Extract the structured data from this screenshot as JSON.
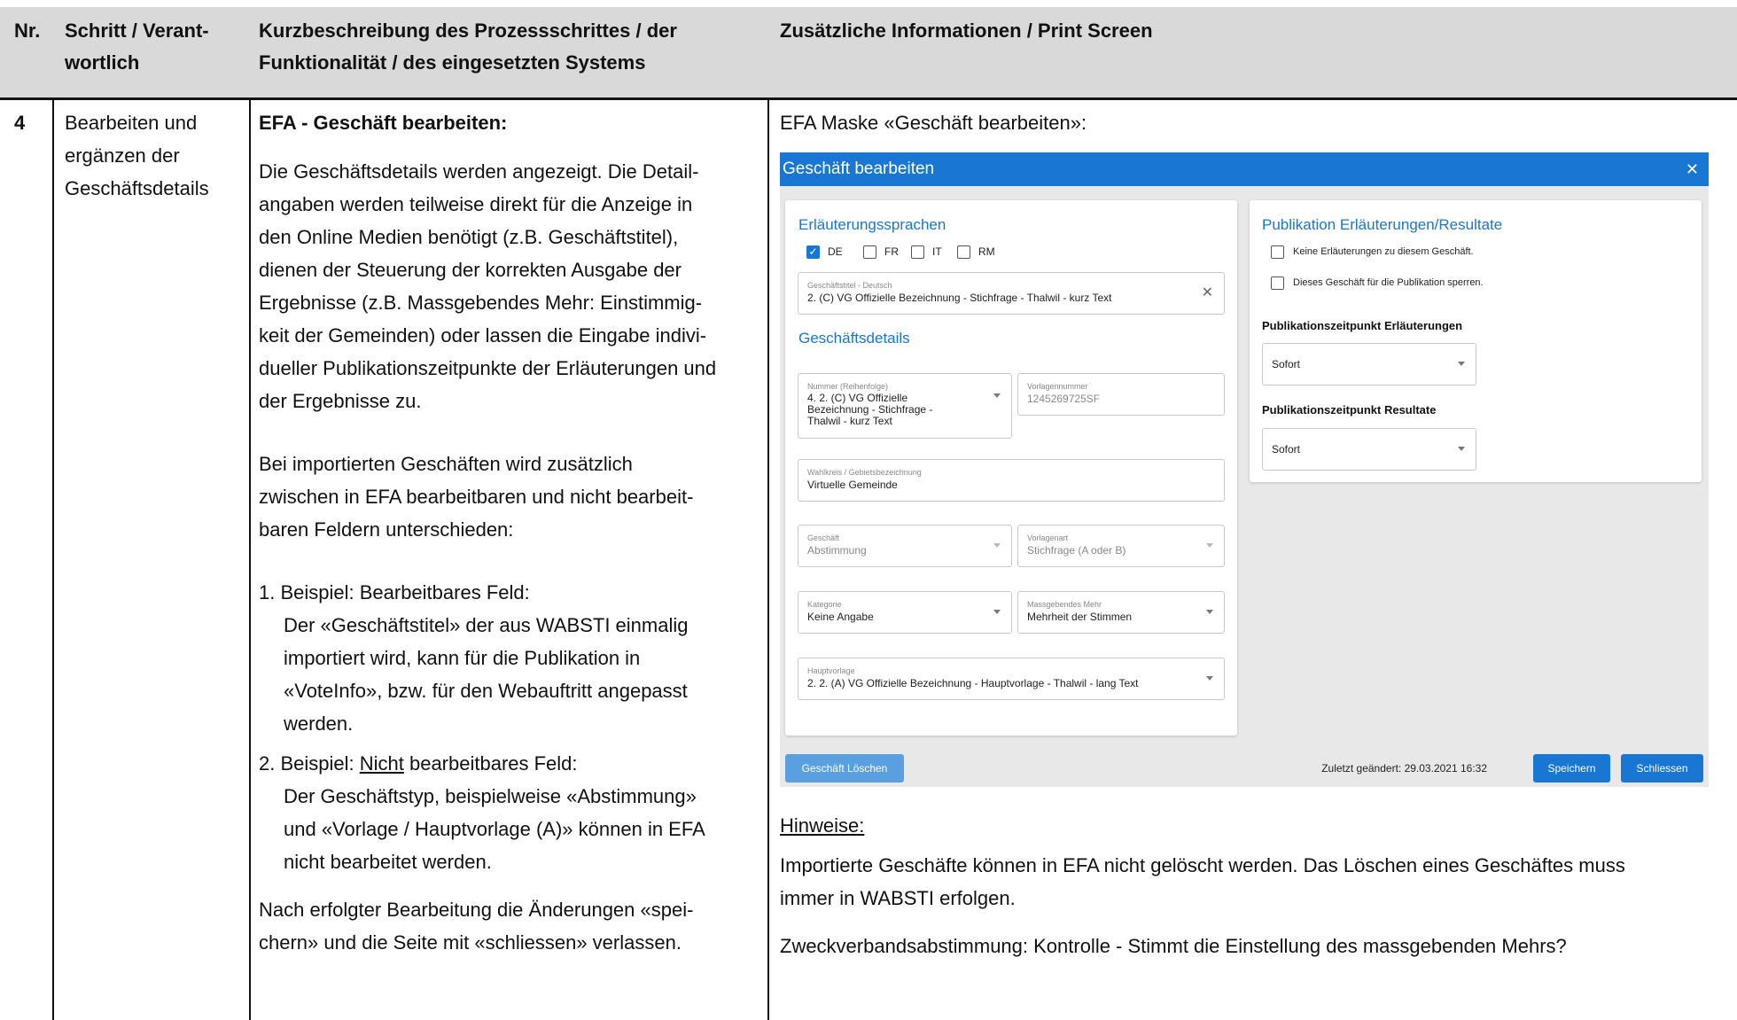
{
  "header": {
    "col1": "Nr.",
    "col2_line1": "Schritt / Verant-",
    "col2_line2": "wortlich",
    "col3_line1": "Kurzbeschreibung des Prozessschrittes / der",
    "col3_line2": "Funktionalität / des eingesetzten Systems",
    "col4": "Zusätzliche Informationen / Print Screen"
  },
  "row": {
    "nr": "4",
    "step_lines": [
      "Bearbeiten und",
      "ergänzen der",
      "Geschäftsdetails"
    ],
    "title": "EFA - Geschäft bearbeiten:",
    "desc_lines": [
      "Die Geschäftsdetails werden angezeigt. Die Detail-",
      "angaben werden teilweise direkt für die Anzeige in",
      "den Online Medien benötigt (z.B. Geschäftstitel),",
      "dienen der Steuerung der korrekten Ausgabe der",
      "Ergebnisse (z.B. Massgebendes Mehr: Einstimmig-",
      "keit der Gemeinden) oder lassen die Eingabe indivi-",
      "dueller Publikationszeitpunkte der Erläuterungen und",
      "der Ergebnisse zu."
    ],
    "import_lines": [
      "Bei importierten Geschäften wird zusätzlich",
      "zwischen in EFA bearbeitbaren und nicht bearbeit-",
      "baren Feldern unterschieden:"
    ],
    "ex1_title": "1. Beispiel: Bearbeitbares Feld:",
    "ex1_lines": [
      "Der «Geschäftstitel» der aus WABSTI einmalig",
      "importiert wird, kann für die Publikation in",
      "«VoteInfo», bzw. für den Webauftritt angepasst",
      "werden."
    ],
    "ex2_prefix": "2. Beispiel: ",
    "ex2_underlined": "Nicht",
    "ex2_suffix": " bearbeitbares Feld:",
    "ex2_lines": [
      "Der Geschäftstyp, beispielweise «Abstimmung»",
      "und «Vorlage / Hauptvorlage (A)» können in EFA",
      "nicht bearbeitet werden."
    ],
    "final_lines": [
      "Nach erfolgter Bearbeitung die Änderungen «spei-",
      "chern» und die Seite mit «schliessen» verlassen."
    ],
    "info_caption": "EFA Maske «Geschäft bearbeiten»:",
    "hinweise_title": "Hinweise:",
    "hinweise_lines": [
      "Importierte Geschäfte können in EFA nicht gelöscht werden. Das Löschen eines Geschäftes muss",
      "immer in WABSTI erfolgen."
    ],
    "zweck_line": "Zweckverbandsabstimmung: Kontrolle - Stimmt die Einstellung des massgebenden Mehrs?"
  },
  "dialog": {
    "title": "Geschäft bearbeiten",
    "close_glyph": "✕",
    "lang_section": "Erläuterungssprachen",
    "languages": [
      {
        "label": "DE",
        "checked": true
      },
      {
        "label": "FR",
        "checked": false
      },
      {
        "label": "IT",
        "checked": false
      },
      {
        "label": "RM",
        "checked": false
      }
    ],
    "titel_label": "Geschäftstitel - Deutsch",
    "titel_value": "2. (C) VG Offizielle Bezeichnung - Stichfrage - Thalwil - kurz Text",
    "details_section": "Geschäftsdetails",
    "nummer_label": "Nummer (Reihenfolge)",
    "nummer_value_lines": [
      "4. 2. (C) VG Offizielle",
      "Bezeichnung - Stichfrage -",
      "Thalwil - kurz Text"
    ],
    "vorlagennummer_label": "Vorlagennummer",
    "vorlagennummer_value": "1245269725SF",
    "wahlkreis_label": "Wahlkreis / Gebietsbezeichnung",
    "wahlkreis_value": "Virtuelle Gemeinde",
    "geschaeft_label": "Geschäft",
    "geschaeft_value": "Abstimmung",
    "vorlagenart_label": "Vorlagenart",
    "vorlagenart_value": "Stichfrage (A oder B)",
    "kategorie_label": "Kategorie",
    "kategorie_value": "Keine Angabe",
    "mehr_label": "Massgebendes Mehr",
    "mehr_value": "Mehrheit der Stimmen",
    "haupt_label": "Hauptvorlage",
    "haupt_value": "2. 2. (A) VG Offizielle Bezeichnung - Hauptvorlage - Thalwil - lang Text",
    "pub_section": "Publikation Erläuterungen/Resultate",
    "pub_cb1": "Keine Erläuterungen zu diesem Geschäft.",
    "pub_cb2": "Dieses Geschäft für die Publikation sperren.",
    "pub_erl_title": "Publikationszeitpunkt Erläuterungen",
    "pub_erl_value": "Sofort",
    "pub_res_title": "Publikationszeitpunkt Resultate",
    "pub_res_value": "Sofort",
    "delete_button": "Geschäft Löschen",
    "last_changed": "Zuletzt geändert: 29.03.2021 16:32",
    "save_button": "Speichern",
    "close_button": "Schliessen",
    "colors": {
      "primary": "#1976d2",
      "disabled_button": "#5a9fe0"
    }
  }
}
